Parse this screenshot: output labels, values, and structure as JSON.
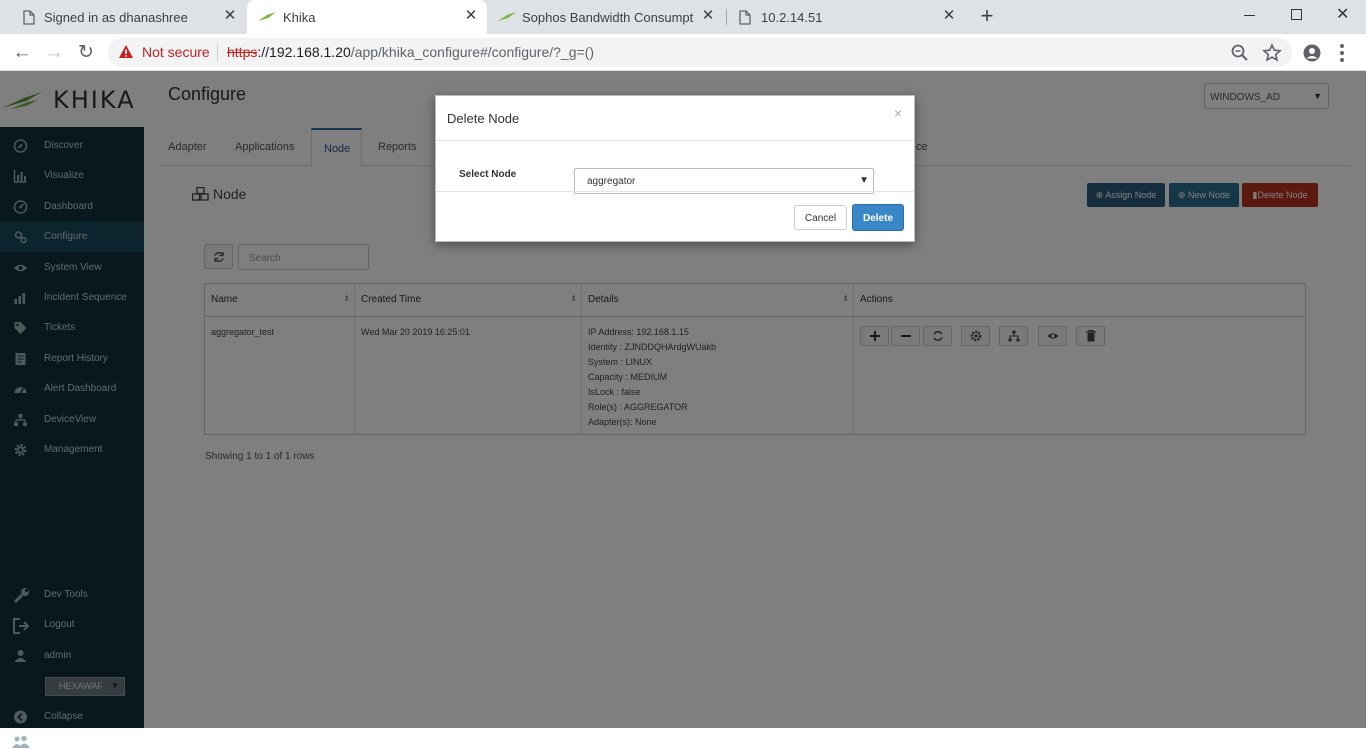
{
  "browser": {
    "tabs": [
      {
        "title": "Signed in as dhanashree",
        "icon": "document-icon"
      },
      {
        "title": "Khika",
        "icon": "khika-favicon",
        "active": true
      },
      {
        "title": "Sophos Bandwidth Consumption",
        "icon": "khika-favicon"
      },
      {
        "title": "10.2.14.51",
        "icon": "document-icon"
      }
    ],
    "new_tab_label": "+",
    "url": {
      "security_label": "Not secure",
      "scheme": "https",
      "host": "://192.168.1.20",
      "path": "/app/khika_configure#/configure/?_g=()"
    }
  },
  "app": {
    "logo_text": "KHKA",
    "page_title": "Configure",
    "workspace": "WINDOWS_AD",
    "sidebar": {
      "items": [
        {
          "label": "Discover",
          "icon": "compass-icon"
        },
        {
          "label": "Visualize",
          "icon": "bar-chart-icon"
        },
        {
          "label": "Dashboard",
          "icon": "dashboard-icon"
        },
        {
          "label": "Configure",
          "icon": "wrench-gear-icon",
          "active": true
        },
        {
          "label": "System View",
          "icon": "eye-icon"
        },
        {
          "label": "Incident Sequence",
          "icon": "sequence-icon"
        },
        {
          "label": "Tickets",
          "icon": "tag-icon"
        },
        {
          "label": "Report History",
          "icon": "book-icon"
        },
        {
          "label": "Alert Dashboard",
          "icon": "gauge-icon"
        },
        {
          "label": "DeviceView",
          "icon": "sitemap-icon"
        },
        {
          "label": "Management",
          "icon": "gear-icon"
        }
      ],
      "bottom_items": [
        {
          "label": "Dev Tools",
          "icon": "wrench-icon"
        },
        {
          "label": "Logout",
          "icon": "logout-icon"
        },
        {
          "label": "admin",
          "icon": "user-icon"
        }
      ],
      "org": "HEXAWAF",
      "collapse_label": "Collapse"
    },
    "tabs": [
      {
        "label": "Adapter"
      },
      {
        "label": "Applications"
      },
      {
        "label": "Node",
        "active": true
      },
      {
        "label": "Reports"
      },
      {
        "label": "ce"
      }
    ],
    "section_title": "Node",
    "buttons": {
      "assign": "Assign Node",
      "new": "New Node",
      "delete": "Delete Node"
    },
    "search_placeholder": "Search",
    "table": {
      "columns": [
        "Name",
        "Created Time",
        "Details",
        "Actions"
      ],
      "rows": [
        {
          "name": "aggregator_test",
          "created": "Wed Mar 20 2019 16:25:01",
          "details": [
            "IP Address: 192.168.1.15",
            "Identity : ZJNDDQHArdgWUakb",
            "System : LINUX",
            "Capacity : MEDIUM",
            "IsLock : false",
            "Role(s) : AGGREGATOR",
            "Adapter(s): None"
          ]
        }
      ],
      "action_icons": [
        "plus-icon",
        "minus-icon",
        "refresh-icon",
        "gear-icon",
        "sitemap-icon",
        "eye-icon",
        "trash-icon"
      ]
    },
    "footer_text": "Showing 1 to 1 of 1 rows"
  },
  "modal": {
    "title": "Delete Node",
    "close": "×",
    "field_label": "Select Node",
    "selected_node": "aggregator",
    "cancel": "Cancel",
    "delete": "Delete"
  },
  "colors": {
    "sidebar_bg": "#10303a",
    "sidebar_active": "#18485a",
    "assign_btn": "#2b5f7e",
    "new_btn": "#2b6f8e",
    "delete_btn": "#b93221",
    "primary_btn": "#3a87c8",
    "logo_green": "#6aa84f"
  }
}
